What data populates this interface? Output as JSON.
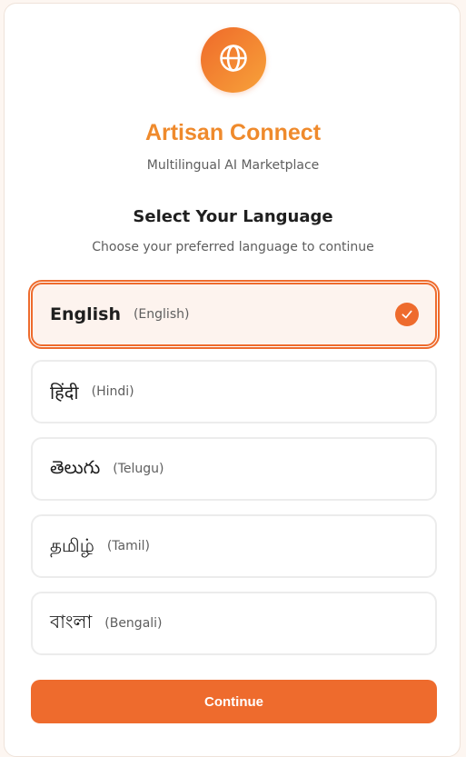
{
  "app": {
    "title": "Artisan Connect",
    "subtitle": "Multilingual AI Marketplace",
    "logo_icon": "globe-icon"
  },
  "language_section": {
    "title": "Select Your Language",
    "subtitle": "Choose your preferred language to continue"
  },
  "languages": [
    {
      "native": "English",
      "english": "(English)",
      "selected": true
    },
    {
      "native": "हिंदी",
      "english": "(Hindi)",
      "selected": false
    },
    {
      "native": "తెలుగు",
      "english": "(Telugu)",
      "selected": false
    },
    {
      "native": "தமிழ்",
      "english": "(Tamil)",
      "selected": false
    },
    {
      "native": "বাংলা",
      "english": "(Bengali)",
      "selected": false
    }
  ],
  "continue_label": "Continue",
  "colors": {
    "accent": "#ee6b2d",
    "title": "#ef8a2c",
    "selected_bg": "#fdf3ee"
  }
}
